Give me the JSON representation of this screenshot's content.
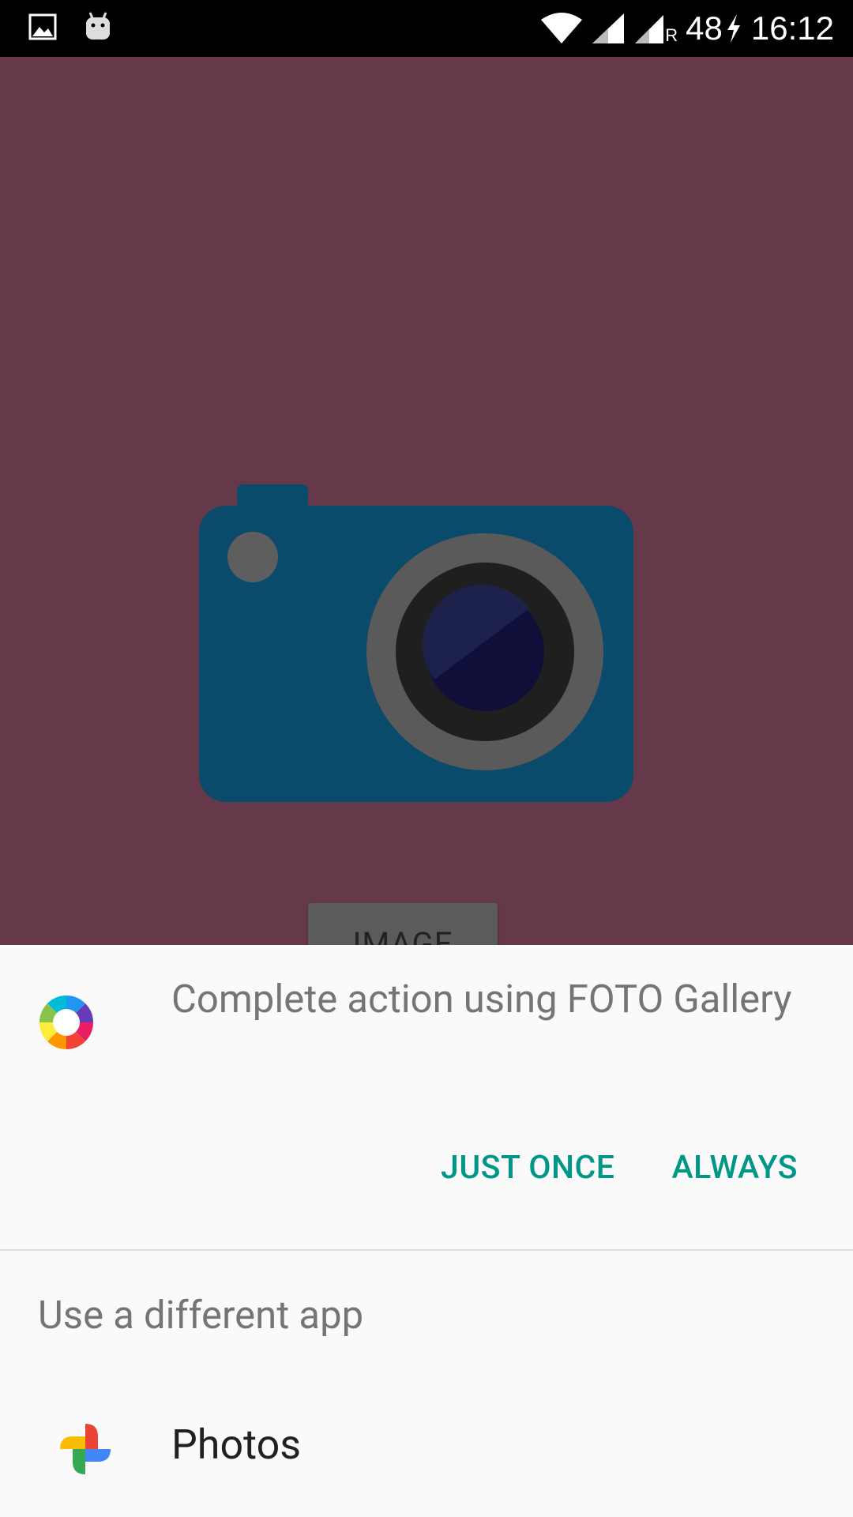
{
  "status_bar": {
    "battery": "48",
    "time": "16:12",
    "roaming_indicator": "R",
    "icons": [
      "image-notification-icon",
      "android-debug-icon",
      "wifi-icon",
      "cell-signal-icon",
      "cell-signal-roaming-icon",
      "charging-icon"
    ]
  },
  "background_app": {
    "button_label": "IMAGE",
    "background_color": "#66394a",
    "camera_color": "#0a4a6a"
  },
  "chooser": {
    "title": "Complete action using FOTO Gallery",
    "app_icon": "foto-gallery-icon",
    "just_once_label": "JUST ONCE",
    "always_label": "ALWAYS",
    "accent_color": "#009688",
    "subheading": "Use a different app",
    "apps": [
      {
        "label": "Photos",
        "icon": "google-photos-icon"
      }
    ]
  }
}
